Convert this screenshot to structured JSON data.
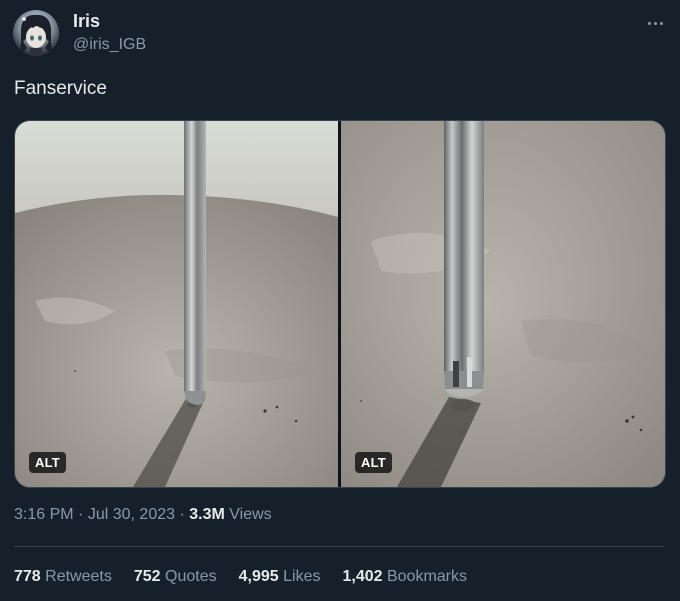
{
  "author": {
    "name": "Iris",
    "handle": "@iris_IGB",
    "avatar_icon": "anime-avatar"
  },
  "tweet": {
    "text": "Fanservice"
  },
  "media": {
    "images": [
      {
        "alt_label": "ALT"
      },
      {
        "alt_label": "ALT"
      }
    ]
  },
  "meta": {
    "time": "3:16 PM",
    "separator": "·",
    "date": "Jul 30, 2023",
    "views_count": "3.3M",
    "views_label": "Views"
  },
  "stats": {
    "retweets": {
      "count": "778",
      "label": "Retweets"
    },
    "quotes": {
      "count": "752",
      "label": "Quotes"
    },
    "likes": {
      "count": "4,995",
      "label": "Likes"
    },
    "bookmarks": {
      "count": "1,402",
      "label": "Bookmarks"
    }
  },
  "colors": {
    "background": "#15202b",
    "text_primary": "#e7e9ea",
    "text_secondary": "#8b98a5",
    "divider": "#38444d"
  }
}
